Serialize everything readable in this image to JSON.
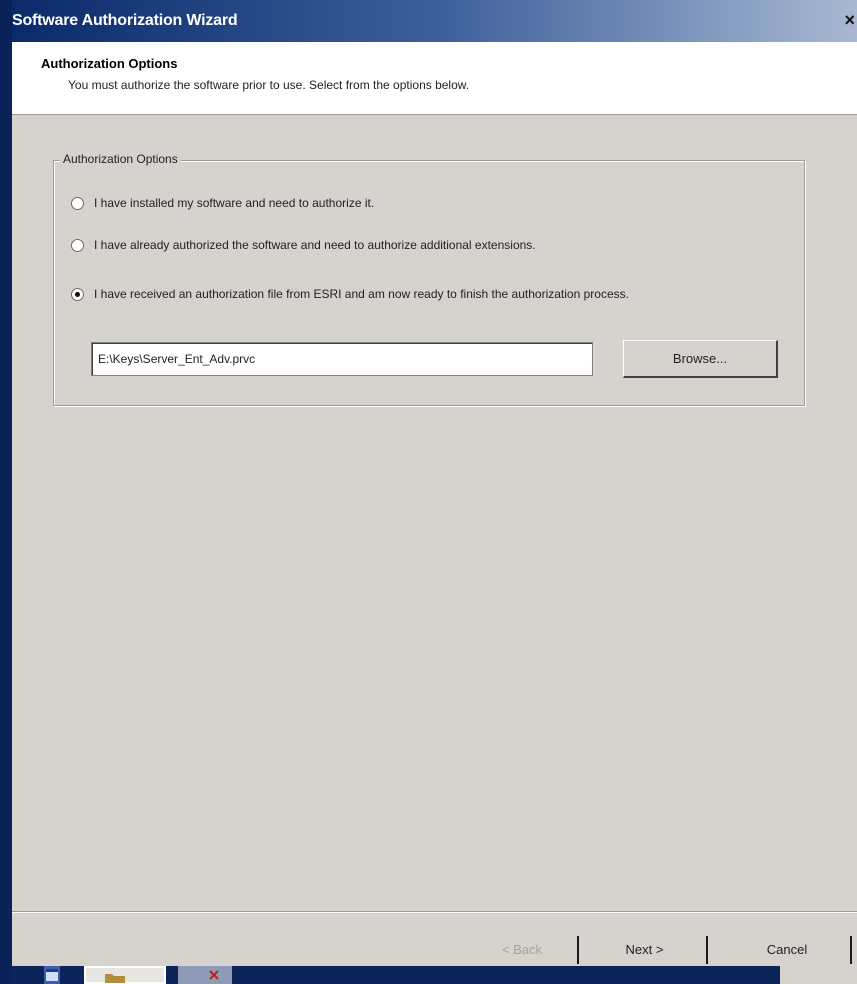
{
  "window": {
    "title": "Software Authorization Wizard",
    "close_glyph": "×"
  },
  "header": {
    "title": "Authorization Options",
    "subtitle": "You must authorize the software prior to use. Select from the options below."
  },
  "group": {
    "legend": "Authorization Options",
    "options": [
      {
        "label": "I have installed my software and need to authorize it.",
        "checked": false
      },
      {
        "label": "I have already authorized the software and need to authorize additional extensions.",
        "checked": false
      },
      {
        "label": "I have received an authorization file from ESRI and am now ready to finish the authorization process.",
        "checked": true
      }
    ],
    "file_path": "E:\\Keys\\Server_Ent_Adv.prvc",
    "browse_label": "Browse..."
  },
  "footer": {
    "back_label": "< Back",
    "next_label": "Next >",
    "cancel_label": "Cancel"
  },
  "icons": {
    "taskbar_window": "window-icon",
    "taskbar_folder": "folder-icon",
    "taskbar_close": "close-icon"
  },
  "colors": {
    "titlebar_start": "#0a2a6b",
    "titlebar_end": "#a8b8d2",
    "dialog_face": "#d6d3ce",
    "desktop": "#0a1f4e"
  }
}
